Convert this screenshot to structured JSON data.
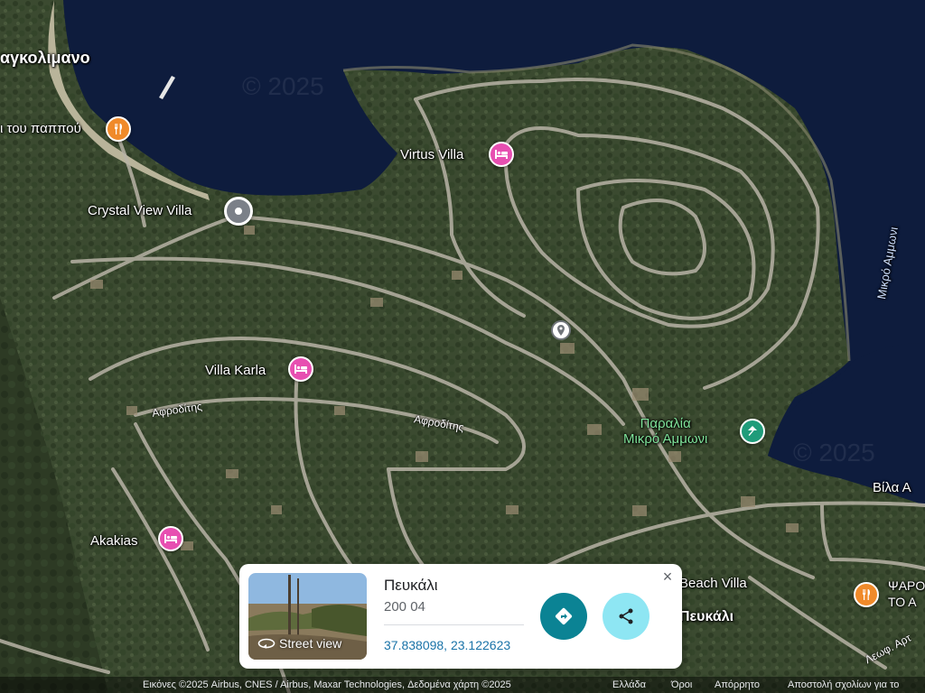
{
  "map": {
    "place_labels": {
      "agkolimano": "αγκολιμανο",
      "tou_pappou": "ι του παππού",
      "crystal_view_villa": "Crystal View Villa",
      "virtus_villa": "Virtus Villa",
      "villa_karla": "Villa Karla",
      "akakias": "Akakias",
      "paralia": "Παραλία",
      "mikro_ammoni": "Μικρό Αμμωνι",
      "vila_a": "Βίλα Α",
      "beach_villa": "Beach Villa",
      "psaro_line1": "ΨΑΡΟ",
      "psaro_line2": "ΤΟ Α",
      "pefkali_map": "Πευκάλι",
      "mikro_ammoni_water": "Μικρό Αμμωνι",
      "afroditis_1": "Αφροδίτης",
      "afroditis_2": "Αφροδίτης",
      "leof_art": "Λεωφ. Αρτ"
    },
    "watermark_1": "© 2025",
    "watermark_2": "© 2025",
    "icons": {
      "restaurant": "fork-knife-icon",
      "hotel": "bed-icon",
      "beach": "umbrella-icon",
      "location": "map-pin-icon"
    },
    "colors": {
      "sea": "#0d1a3a",
      "land": "#3a4a2e",
      "road": "#b8b3a6",
      "hotel_pin": "#e74fb1",
      "restaurant_pin": "#f08a2a",
      "beach_pin": "#1f9c7a",
      "beach_label": "#7fe39a"
    }
  },
  "card": {
    "title": "Πευκάλι",
    "postal_code": "200 04",
    "coordinates": "37.838098, 23.122623",
    "street_view_label": "Street view",
    "close_label": "×",
    "directions_icon": "directions-icon",
    "share_icon": "share-icon"
  },
  "footer": {
    "attribution": "Εικόνες ©2025 Airbus, CNES / Airbus, Maxar Technologies, Δεδομένα χάρτη ©2025",
    "country": "Ελλάδα",
    "terms": "Όροι",
    "privacy": "Απόρρητο",
    "feedback": "Αποστολή σχολίων για το"
  }
}
